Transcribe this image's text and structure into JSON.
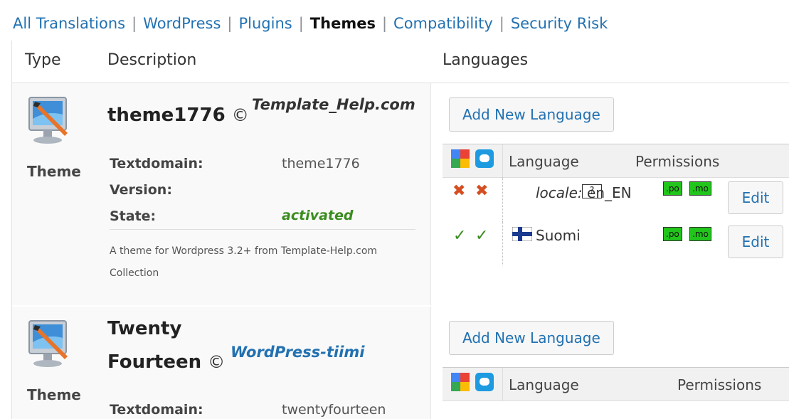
{
  "filters": [
    {
      "label": "All Translations",
      "current": false
    },
    {
      "label": "WordPress",
      "current": false
    },
    {
      "label": "Plugins",
      "current": false
    },
    {
      "label": "Themes",
      "current": true
    },
    {
      "label": "Compatibility",
      "current": false
    },
    {
      "label": "Security Risk",
      "current": false
    }
  ],
  "separator": "|",
  "columns": {
    "type": "Type",
    "description": "Description",
    "languages": "Languages"
  },
  "copyright_symbol": "©",
  "themes": [
    {
      "type": "Theme",
      "name": "theme1776",
      "author": "Template_Help.com",
      "author_color": "#222222",
      "meta": {
        "textdomain_label": "Textdomain:",
        "textdomain": "theme1776",
        "version_label": "Version:",
        "version": "",
        "state_label": "State:",
        "state": "activated"
      },
      "description": "A theme for Wordpress 3.2+ from Template-Help.com Collection",
      "add_language_label": "Add New Language",
      "lang_header": {
        "language": "Language",
        "permissions": "Permissions"
      },
      "languages": [
        {
          "prefix": "locale:",
          "name": "en_EN",
          "flag": "unknown-locale-icon",
          "status": "error",
          "po": ".po",
          "mo": ".mo",
          "edit": "Edit"
        },
        {
          "prefix": "",
          "name": "Suomi",
          "flag": "finland-flag-icon",
          "status": "ok",
          "po": ".po",
          "mo": ".mo",
          "edit": "Edit"
        }
      ]
    },
    {
      "type": "Theme",
      "name_line1": "Twenty",
      "name_line2": "Fourteen",
      "author": "WordPress-tiimi",
      "author_color": "#2271b1",
      "meta": {
        "textdomain_label": "Textdomain:",
        "textdomain": "twentyfourteen"
      },
      "add_language_label": "Add New Language",
      "lang_header": {
        "language": "Language",
        "permissions": "Permissions"
      }
    }
  ],
  "colors": {
    "link": "#2271b1",
    "state_active": "#3a8c1e",
    "perm_ok": "#22c51b",
    "error_mark": "#d54e21"
  },
  "icons": [
    "theme-monitor-icon",
    "google-translate-icon",
    "bing-translate-icon",
    "error-x-icon",
    "check-icon",
    "finland-flag-icon",
    "unknown-locale-icon"
  ]
}
